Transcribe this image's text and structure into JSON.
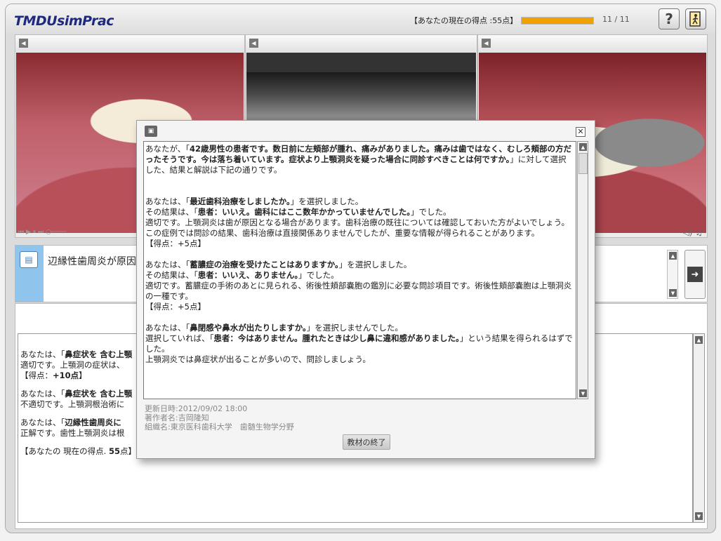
{
  "header": {
    "logo": "TMDUsimPrac",
    "score_label": "【あなたの現在の得点 :55点】",
    "progress": 1.0,
    "progress_count": "11 / 11",
    "help_label": "?",
    "exit_icon": "exit-door-icon"
  },
  "media": {
    "panels": [
      {
        "image": "intraoral-photo-left"
      },
      {
        "image": "panoramic-xray"
      },
      {
        "image": "intraoral-photo-right"
      }
    ]
  },
  "question": {
    "text": "辺縁性歯周炎が原因"
  },
  "results": {
    "lines": [
      {
        "a": "あなたは、「",
        "b": "鼻症状を 含む上顎",
        "c": ""
      },
      {
        "a": "適切です。上顎洞の症状は、",
        "b": "",
        "c": ""
      },
      {
        "a": "【得点：",
        "b": "+10点",
        "c": "】"
      },
      {
        "a": "あなたは、「",
        "b": "鼻症状を 含む上顎",
        "c": ""
      },
      {
        "a": "不適切です。上顎洞根治術に",
        "b": "",
        "c": ""
      },
      {
        "a": "あなたは、「",
        "b": "辺縁性歯周炎に",
        "c": ""
      },
      {
        "a": "正解です。歯性上顎洞炎は根",
        "b": "",
        "c": ""
      },
      {
        "a": "【あなたの 現在の得点. ",
        "b": "55",
        "c": "点】"
      }
    ]
  },
  "dialog": {
    "intro_pre": "あなたが、「",
    "intro_bold": "42歳男性の患者です。数日前に左頬部が腫れ、痛みがありました。痛みは歯ではなく、むしろ頬部の方だったそうです。今は落ち着いています。症状より上顎洞炎を疑った場合に同診すべきことは何ですか。",
    "intro_post": "」に対して選択した、結果と解説は下記の通りです。",
    "items": [
      {
        "l1_pre": "あなたは、「",
        "l1_bold": "最近歯科治療をしましたか。",
        "l1_post": "」を選択しました。",
        "l2_pre": "その結果は、「",
        "l2_bold": "患者：いいえ。歯科にはここ数年かかっていませんでした。",
        "l2_post": "」でした。",
        "l3": "適切です。上顎洞炎は歯が原因となる場合があります。歯科治療の既往については確認しておいた方がよいでしょう。この症例では問診の結果、歯科治療は直接関係ありませんでしたが、重要な情報が得られることがあります。",
        "score": "【得点：+5点】"
      },
      {
        "l1_pre": "あなたは、「",
        "l1_bold": "蓄膿症の治療を受けたことはありますか。",
        "l1_post": "」を選択しました。",
        "l2_pre": "その結果は、「",
        "l2_bold": "患者：いいえ、ありません。",
        "l2_post": "」でした。",
        "l3": "適切です。蓄膿症の手術のあとに見られる、術後性頬部嚢胞の鑑別に必要な問診項目です。術後性頬部嚢胞は上顎洞炎の一種です。",
        "score": "【得点：+5点】"
      },
      {
        "l1_pre": "あなたは、「",
        "l1_bold": "鼻閉感や鼻水が出たりしますか。",
        "l1_post": "」を選択しませんでした。",
        "l2_pre": "選択していれば、「",
        "l2_bold": "患者：今はありません。腫れたときは少し鼻に違和感がありました。",
        "l2_post": "」という結果を得られるはずでした。",
        "l3": "上顎洞炎では鼻症状が出ることが多いので、問診しましょう。",
        "score": ""
      }
    ],
    "meta_updated": "更新日時:2012/09/02 18:00",
    "meta_author": "著作者名:吉岡隆知",
    "meta_org": "組織名:東京医科歯科大学　歯髄生物学分野",
    "end_button": "教材の終了"
  }
}
